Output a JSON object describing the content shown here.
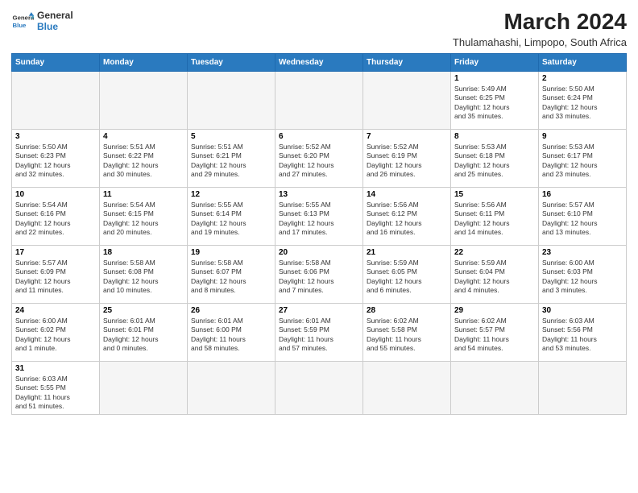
{
  "logo": {
    "line1": "General",
    "line2": "Blue"
  },
  "title": "March 2024",
  "subtitle": "Thulamahashi, Limpopo, South Africa",
  "weekdays": [
    "Sunday",
    "Monday",
    "Tuesday",
    "Wednesday",
    "Thursday",
    "Friday",
    "Saturday"
  ],
  "weeks": [
    [
      {
        "day": "",
        "info": ""
      },
      {
        "day": "",
        "info": ""
      },
      {
        "day": "",
        "info": ""
      },
      {
        "day": "",
        "info": ""
      },
      {
        "day": "",
        "info": ""
      },
      {
        "day": "1",
        "info": "Sunrise: 5:49 AM\nSunset: 6:25 PM\nDaylight: 12 hours\nand 35 minutes."
      },
      {
        "day": "2",
        "info": "Sunrise: 5:50 AM\nSunset: 6:24 PM\nDaylight: 12 hours\nand 33 minutes."
      }
    ],
    [
      {
        "day": "3",
        "info": "Sunrise: 5:50 AM\nSunset: 6:23 PM\nDaylight: 12 hours\nand 32 minutes."
      },
      {
        "day": "4",
        "info": "Sunrise: 5:51 AM\nSunset: 6:22 PM\nDaylight: 12 hours\nand 30 minutes."
      },
      {
        "day": "5",
        "info": "Sunrise: 5:51 AM\nSunset: 6:21 PM\nDaylight: 12 hours\nand 29 minutes."
      },
      {
        "day": "6",
        "info": "Sunrise: 5:52 AM\nSunset: 6:20 PM\nDaylight: 12 hours\nand 27 minutes."
      },
      {
        "day": "7",
        "info": "Sunrise: 5:52 AM\nSunset: 6:19 PM\nDaylight: 12 hours\nand 26 minutes."
      },
      {
        "day": "8",
        "info": "Sunrise: 5:53 AM\nSunset: 6:18 PM\nDaylight: 12 hours\nand 25 minutes."
      },
      {
        "day": "9",
        "info": "Sunrise: 5:53 AM\nSunset: 6:17 PM\nDaylight: 12 hours\nand 23 minutes."
      }
    ],
    [
      {
        "day": "10",
        "info": "Sunrise: 5:54 AM\nSunset: 6:16 PM\nDaylight: 12 hours\nand 22 minutes."
      },
      {
        "day": "11",
        "info": "Sunrise: 5:54 AM\nSunset: 6:15 PM\nDaylight: 12 hours\nand 20 minutes."
      },
      {
        "day": "12",
        "info": "Sunrise: 5:55 AM\nSunset: 6:14 PM\nDaylight: 12 hours\nand 19 minutes."
      },
      {
        "day": "13",
        "info": "Sunrise: 5:55 AM\nSunset: 6:13 PM\nDaylight: 12 hours\nand 17 minutes."
      },
      {
        "day": "14",
        "info": "Sunrise: 5:56 AM\nSunset: 6:12 PM\nDaylight: 12 hours\nand 16 minutes."
      },
      {
        "day": "15",
        "info": "Sunrise: 5:56 AM\nSunset: 6:11 PM\nDaylight: 12 hours\nand 14 minutes."
      },
      {
        "day": "16",
        "info": "Sunrise: 5:57 AM\nSunset: 6:10 PM\nDaylight: 12 hours\nand 13 minutes."
      }
    ],
    [
      {
        "day": "17",
        "info": "Sunrise: 5:57 AM\nSunset: 6:09 PM\nDaylight: 12 hours\nand 11 minutes."
      },
      {
        "day": "18",
        "info": "Sunrise: 5:58 AM\nSunset: 6:08 PM\nDaylight: 12 hours\nand 10 minutes."
      },
      {
        "day": "19",
        "info": "Sunrise: 5:58 AM\nSunset: 6:07 PM\nDaylight: 12 hours\nand 8 minutes."
      },
      {
        "day": "20",
        "info": "Sunrise: 5:58 AM\nSunset: 6:06 PM\nDaylight: 12 hours\nand 7 minutes."
      },
      {
        "day": "21",
        "info": "Sunrise: 5:59 AM\nSunset: 6:05 PM\nDaylight: 12 hours\nand 6 minutes."
      },
      {
        "day": "22",
        "info": "Sunrise: 5:59 AM\nSunset: 6:04 PM\nDaylight: 12 hours\nand 4 minutes."
      },
      {
        "day": "23",
        "info": "Sunrise: 6:00 AM\nSunset: 6:03 PM\nDaylight: 12 hours\nand 3 minutes."
      }
    ],
    [
      {
        "day": "24",
        "info": "Sunrise: 6:00 AM\nSunset: 6:02 PM\nDaylight: 12 hours\nand 1 minute."
      },
      {
        "day": "25",
        "info": "Sunrise: 6:01 AM\nSunset: 6:01 PM\nDaylight: 12 hours\nand 0 minutes."
      },
      {
        "day": "26",
        "info": "Sunrise: 6:01 AM\nSunset: 6:00 PM\nDaylight: 11 hours\nand 58 minutes."
      },
      {
        "day": "27",
        "info": "Sunrise: 6:01 AM\nSunset: 5:59 PM\nDaylight: 11 hours\nand 57 minutes."
      },
      {
        "day": "28",
        "info": "Sunrise: 6:02 AM\nSunset: 5:58 PM\nDaylight: 11 hours\nand 55 minutes."
      },
      {
        "day": "29",
        "info": "Sunrise: 6:02 AM\nSunset: 5:57 PM\nDaylight: 11 hours\nand 54 minutes."
      },
      {
        "day": "30",
        "info": "Sunrise: 6:03 AM\nSunset: 5:56 PM\nDaylight: 11 hours\nand 53 minutes."
      }
    ],
    [
      {
        "day": "31",
        "info": "Sunrise: 6:03 AM\nSunset: 5:55 PM\nDaylight: 11 hours\nand 51 minutes."
      },
      {
        "day": "",
        "info": ""
      },
      {
        "day": "",
        "info": ""
      },
      {
        "day": "",
        "info": ""
      },
      {
        "day": "",
        "info": ""
      },
      {
        "day": "",
        "info": ""
      },
      {
        "day": "",
        "info": ""
      }
    ]
  ]
}
